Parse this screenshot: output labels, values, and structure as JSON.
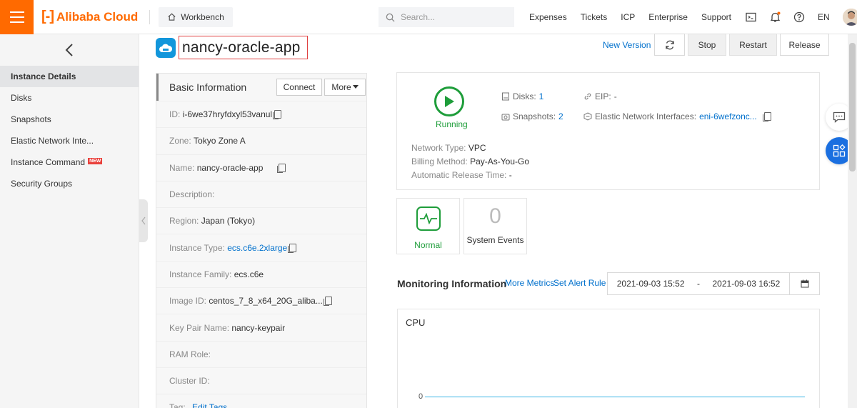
{
  "topbar": {
    "logo_mark": "[-]",
    "logo_text": "Alibaba Cloud",
    "workbench_label": "Workbench",
    "search_placeholder": "Search...",
    "nav": [
      "Expenses",
      "Tickets",
      "ICP",
      "Enterprise",
      "Support"
    ],
    "lang": "EN"
  },
  "sidebar": {
    "items": [
      {
        "label": "Instance Details",
        "active": true
      },
      {
        "label": "Disks"
      },
      {
        "label": "Snapshots"
      },
      {
        "label": "Elastic Network Inte..."
      },
      {
        "label": "Instance Command",
        "badge": "NEW"
      },
      {
        "label": "Security Groups"
      }
    ]
  },
  "header": {
    "title": "nancy-oracle-app",
    "new_version": "New Version",
    "stop": "Stop",
    "restart": "Restart",
    "release": "Release"
  },
  "basic": {
    "title": "Basic Information",
    "connect": "Connect",
    "more": "More",
    "rows": [
      {
        "label": "ID:",
        "value": "i-6we37hryfdxyl53vanul",
        "copy": true
      },
      {
        "label": "Zone:",
        "value": "Tokyo Zone A"
      },
      {
        "label": "Name:",
        "value": "nancy-oracle-app",
        "copy": true
      },
      {
        "label": "Description:",
        "value": ""
      },
      {
        "label": "Region:",
        "value": "Japan (Tokyo)"
      },
      {
        "label": "Instance Type:",
        "value": "ecs.c6e.2xlarge",
        "link": true,
        "copy": true
      },
      {
        "label": "Instance Family:",
        "value": "ecs.c6e"
      },
      {
        "label": "Image ID:",
        "value": "centos_7_8_x64_20G_aliba...",
        "copy": true
      },
      {
        "label": "Key Pair Name:",
        "value": "nancy-keypair"
      },
      {
        "label": "RAM Role:",
        "value": ""
      },
      {
        "label": "Cluster ID:",
        "value": ""
      },
      {
        "label": "Tag:",
        "value": "Edit Tags",
        "link": true
      }
    ]
  },
  "status": {
    "state": "Running",
    "disks_label": "Disks:",
    "disks_count": "1",
    "snapshots_label": "Snapshots:",
    "snapshots_count": "2",
    "eip_label": "EIP:",
    "eip_value": "-",
    "eni_label": "Elastic Network Interfaces:",
    "eni_value": "eni-6wefzonc...",
    "network_type_label": "Network Type:",
    "network_type": "VPC",
    "billing_label": "Billing Method:",
    "billing": "Pay-As-You-Go",
    "release_label": "Automatic Release Time:",
    "release_time": "-"
  },
  "health": {
    "label": "Normal"
  },
  "events": {
    "count": "0",
    "label": "System Events"
  },
  "monitoring": {
    "title": "Monitoring Information",
    "more_metrics": "More Metrics",
    "set_alert": "Set Alert Rule",
    "start": "2021-09-03 15:52",
    "sep": "-",
    "end": "2021-09-03 16:52"
  },
  "cpu": {
    "title": "CPU",
    "y_tick": "0"
  },
  "colors": {
    "accent": "#ff6a00",
    "link": "#0070cc",
    "running": "#1e9d3a",
    "float_blue": "#1a6fe0"
  }
}
